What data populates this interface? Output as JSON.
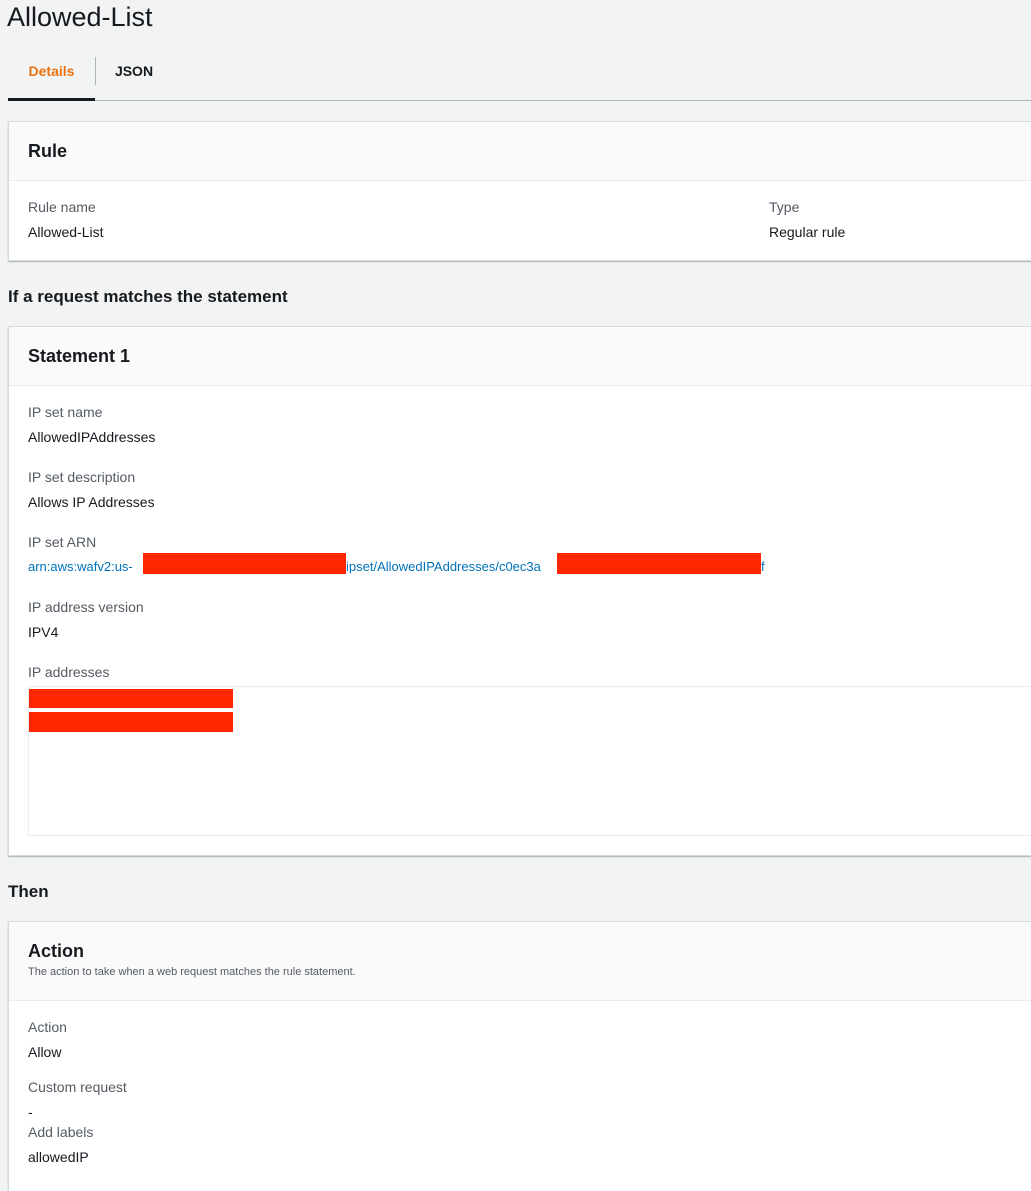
{
  "page": {
    "title": "Allowed-List"
  },
  "tabs": [
    {
      "label": "Details",
      "active": true
    },
    {
      "label": "JSON",
      "active": false
    }
  ],
  "rule_panel": {
    "title": "Rule",
    "rule_name_label": "Rule name",
    "rule_name_value": "Allowed-List",
    "type_label": "Type",
    "type_value": "Regular rule"
  },
  "statement_section": {
    "heading": "If a request matches the statement"
  },
  "statement_panel": {
    "title": "Statement 1",
    "ip_set_name_label": "IP set name",
    "ip_set_name_value": "AllowedIPAddresses",
    "ip_set_description_label": "IP set description",
    "ip_set_description_value": "Allows IP Addresses",
    "ip_set_arn_label": "IP set ARN",
    "ip_set_arn_part1": "arn:aws:wafv2:us-",
    "ip_set_arn_part2": "ipset/AllowedIPAddresses/c0ec3a",
    "ip_set_arn_part3": "f",
    "ip_version_label": "IP address version",
    "ip_version_value": "IPV4",
    "ip_addresses_label": "IP addresses"
  },
  "then_section": {
    "heading": "Then"
  },
  "action_panel": {
    "title": "Action",
    "description": "The action to take when a web request matches the rule statement.",
    "action_label": "Action",
    "action_value": "Allow",
    "custom_request_label": "Custom request",
    "custom_request_value": "-",
    "add_labels_label": "Add labels",
    "add_labels_value": "allowedIP"
  },
  "colors": {
    "accent_orange": "#ec7211",
    "link_blue": "#0073bb",
    "redaction_red": "#ff2600",
    "background": "#f2f3f3"
  }
}
